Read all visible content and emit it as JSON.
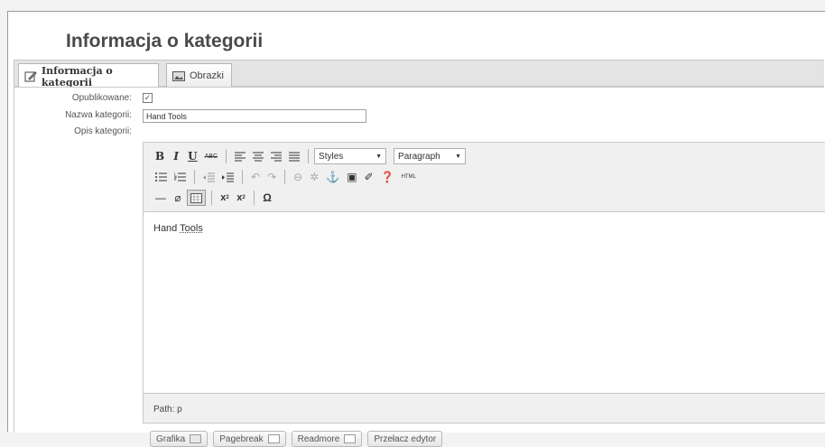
{
  "page_title": "Informacja o kategorii",
  "tabs": [
    {
      "label": "Informacja o kategorii",
      "icon": "edit-icon",
      "active": true
    },
    {
      "label": "Obrazki",
      "icon": "image-icon",
      "active": false
    }
  ],
  "form": {
    "published_label": "Opublikowane:",
    "published_checked": true,
    "name_label": "Nazwa kategorii:",
    "name_value": "Hand Tools",
    "desc_label": "Opis kategorii:"
  },
  "editor": {
    "styles_select": "Styles",
    "format_select": "Paragraph",
    "content_word1": "Hand",
    "content_word2": "Tools",
    "path_text": "Path: p"
  },
  "bottom_buttons": [
    {
      "label": "Grafika",
      "icon": "image-icon"
    },
    {
      "label": "Pagebreak",
      "icon": "pagebreak-icon"
    },
    {
      "label": "Readmore",
      "icon": "readmore-icon"
    },
    {
      "label": "Przełacz edytor",
      "icon": ""
    }
  ]
}
